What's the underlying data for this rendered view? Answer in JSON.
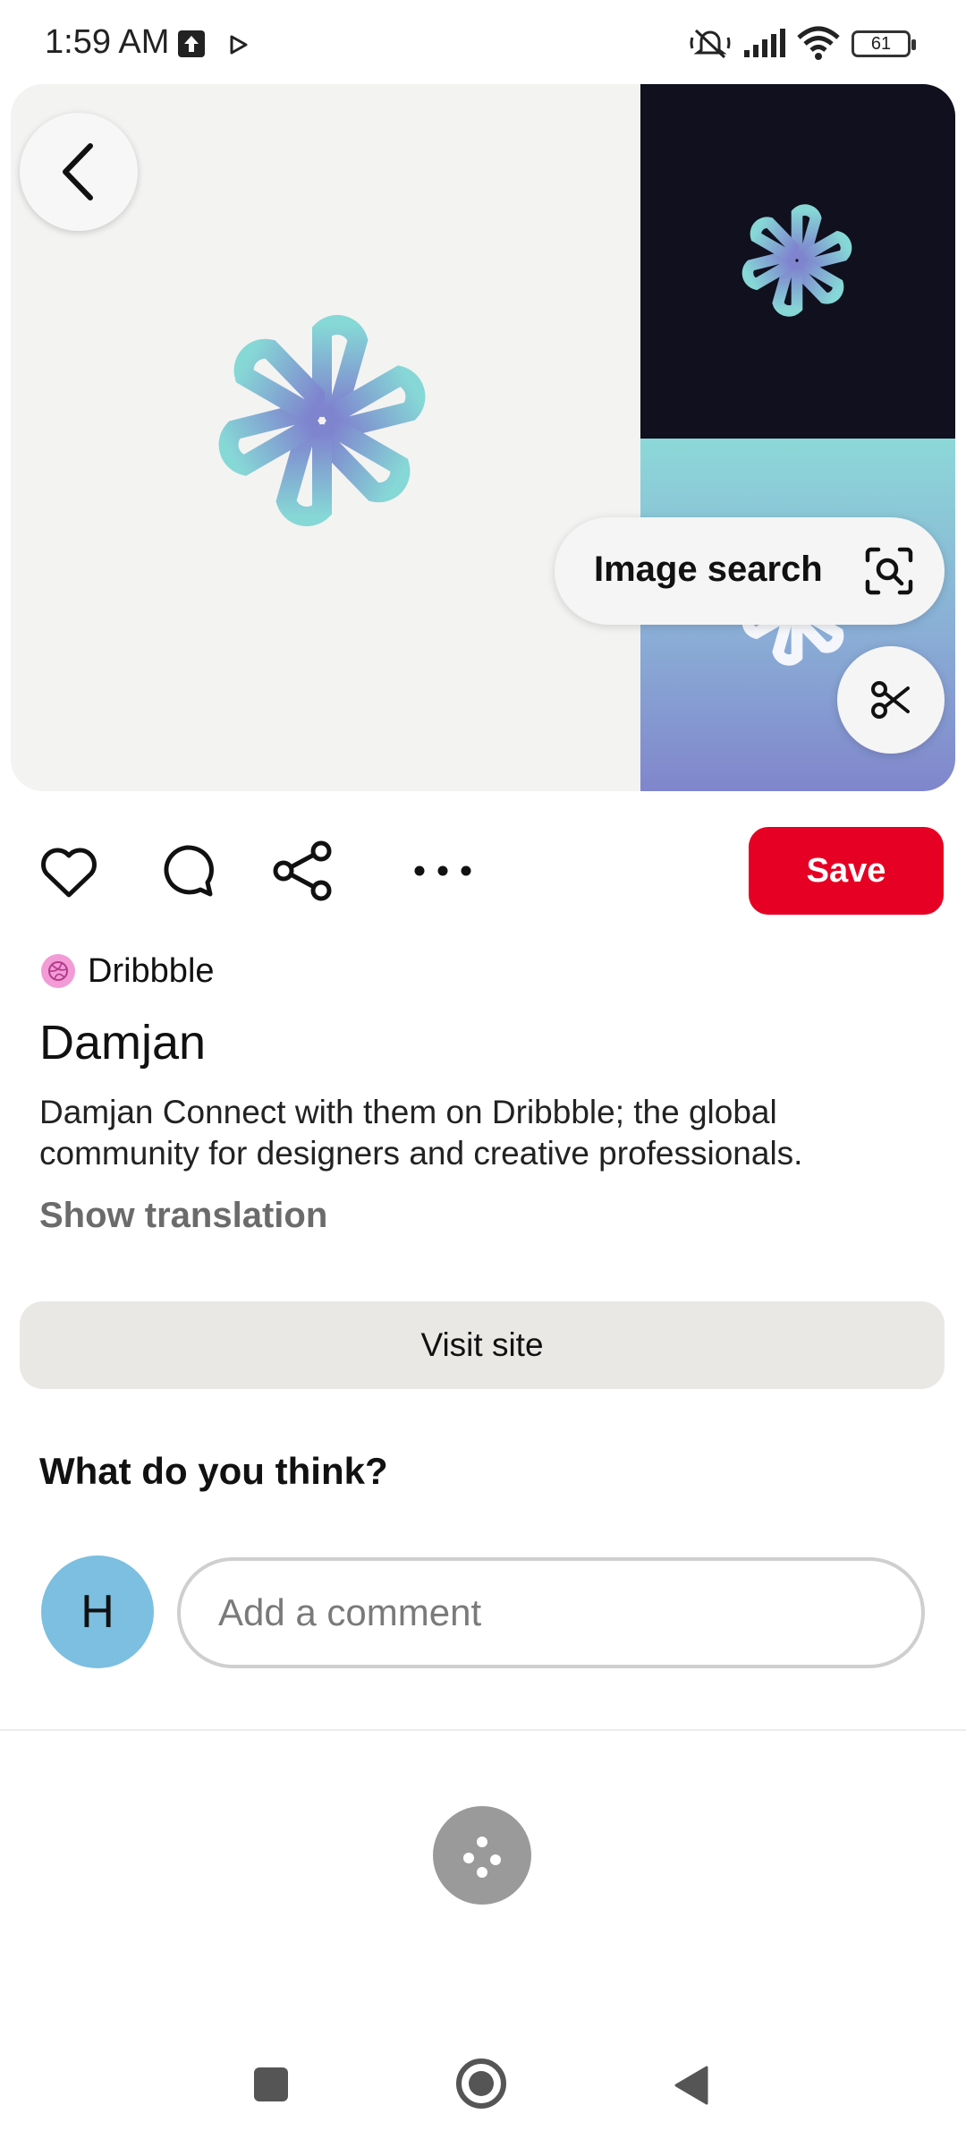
{
  "status_bar": {
    "time": "1:59 AM",
    "battery": "61",
    "icons": [
      "upload-icon",
      "play-icon",
      "silent-icon",
      "signal-icon",
      "wifi-icon",
      "battery-icon"
    ]
  },
  "hero": {
    "image_search_label": "Image search",
    "colors": {
      "left_bg": "#f3f3f2",
      "right_top_bg": "#10101e",
      "right_bottom_gradient": [
        "#8cd8d8",
        "#8086cc"
      ],
      "logo_gradient": [
        "#86d8d6",
        "#7f84cf"
      ]
    }
  },
  "actions": {
    "icons": [
      "heart-icon",
      "comment-icon",
      "share-icon",
      "more-icon"
    ],
    "save_label": "Save",
    "save_color": "#e60023"
  },
  "pin": {
    "source_name": "Dribbble",
    "title": "Damjan",
    "description": "Damjan Connect with them on Dribbble; the global community for designers and creative professionals.",
    "show_translation": "Show translation",
    "visit_site_label": "Visit site"
  },
  "comments": {
    "heading": "What do you think?",
    "user_initial": "H",
    "placeholder": "Add a comment"
  }
}
